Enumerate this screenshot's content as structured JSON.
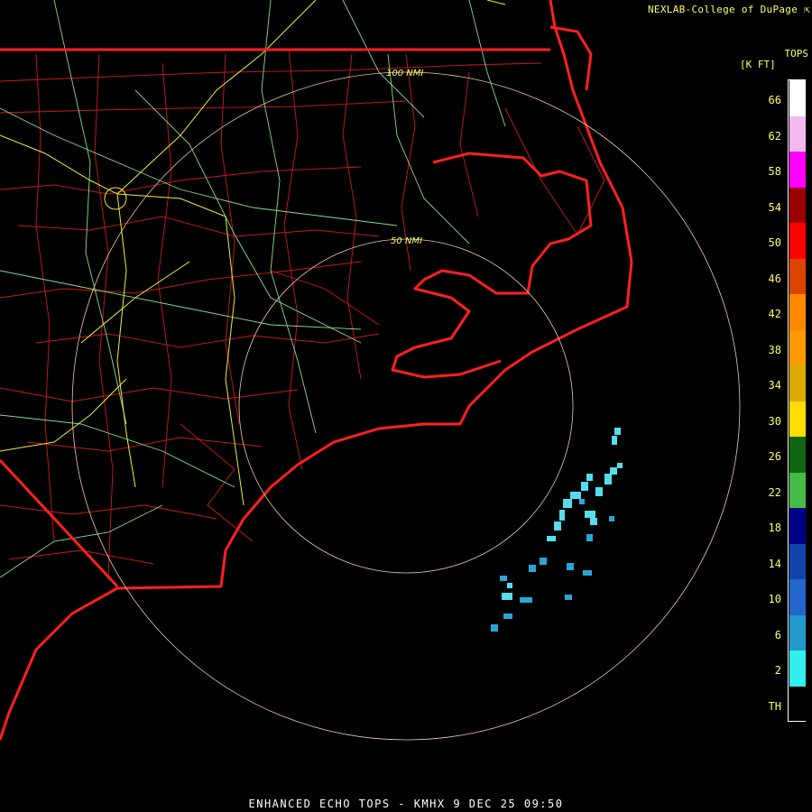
{
  "header": {
    "credit": "NEXLAB-College of DuPage ⇱"
  },
  "footer": {
    "product_line": "ENHANCED ECHO TOPS - KMHX 9 DEC 25 09:50"
  },
  "range_rings": {
    "inner_label": "50 NMI",
    "outer_label": "100 NMI"
  },
  "legend": {
    "title_line1": "TOPS",
    "title_line2": "[K FT]",
    "entries": [
      {
        "label": "66",
        "color": "#ffffff"
      },
      {
        "label": "62",
        "color": "#f4b8f0"
      },
      {
        "label": "58",
        "color": "#ff00ff"
      },
      {
        "label": "54",
        "color": "#9a0000"
      },
      {
        "label": "50",
        "color": "#ff0000"
      },
      {
        "label": "46",
        "color": "#dd4400"
      },
      {
        "label": "42",
        "color": "#ff8800"
      },
      {
        "label": "38",
        "color": "#ff9900"
      },
      {
        "label": "34",
        "color": "#ddaa00"
      },
      {
        "label": "30",
        "color": "#ffdd00"
      },
      {
        "label": "26",
        "color": "#116611"
      },
      {
        "label": "22",
        "color": "#44bb44"
      },
      {
        "label": "18",
        "color": "#000088"
      },
      {
        "label": "14",
        "color": "#1144aa"
      },
      {
        "label": "10",
        "color": "#2266cc"
      },
      {
        "label": "6",
        "color": "#2299cc"
      },
      {
        "label": "2",
        "color": "#33eeee"
      },
      {
        "label": "TH",
        "color": "#000000"
      }
    ]
  },
  "colors": {
    "background": "#000000",
    "state_border": "#ff2020",
    "county_lines": "#cc1a1a",
    "roads_interstate": "#eeee33",
    "roads_highway": "#88dd88",
    "range_rings": "#f4c9a8",
    "echo_light": "#55ddee",
    "echo_mid": "#2aa6d6"
  }
}
